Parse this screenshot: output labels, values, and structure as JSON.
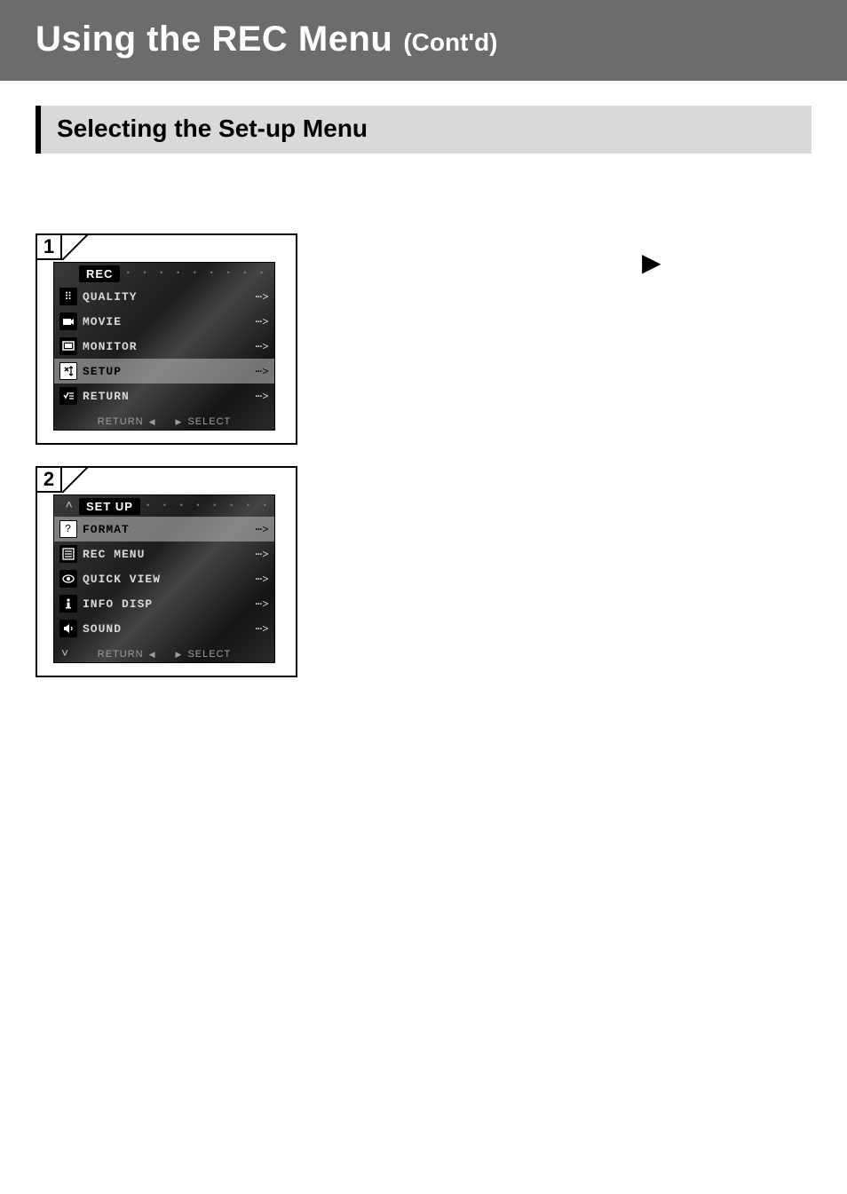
{
  "titlebar": {
    "main": "Using the REC Menu",
    "suffix": "(Cont'd)"
  },
  "section": {
    "heading": "Selecting the Set-up Menu"
  },
  "decor": {
    "play_glyph": "▶"
  },
  "panels": {
    "p1": {
      "number": "1",
      "menu_name": "REC",
      "show_scroll_up": false,
      "show_scroll_down": false,
      "items": [
        {
          "icon": "quality-icon",
          "label": "QUALITY",
          "hot": false
        },
        {
          "icon": "movie-icon",
          "label": "MOVIE",
          "hot": false
        },
        {
          "icon": "monitor-icon",
          "label": "MONITOR",
          "hot": false
        },
        {
          "icon": "setup-icon",
          "label": "SETUP",
          "hot": true
        },
        {
          "icon": "return-icon",
          "label": "RETURN",
          "hot": false
        }
      ],
      "footer": {
        "left": "RETURN",
        "right": "SELECT"
      }
    },
    "p2": {
      "number": "2",
      "menu_name": "SET UP",
      "show_scroll_up": true,
      "show_scroll_down": true,
      "items": [
        {
          "icon": "format-icon",
          "label": "FORMAT",
          "hot": true
        },
        {
          "icon": "recmenu-icon",
          "label": "REC MENU",
          "hot": false
        },
        {
          "icon": "quickview-icon",
          "label": "QUICK VIEW",
          "hot": false
        },
        {
          "icon": "info-icon",
          "label": "INFO DISP",
          "hot": false
        },
        {
          "icon": "sound-icon",
          "label": "SOUND",
          "hot": false
        }
      ],
      "footer": {
        "left": "RETURN",
        "right": "SELECT"
      }
    }
  },
  "icon_text": {
    "quality-icon": "⠿",
    "movie-icon": "🎥",
    "monitor-icon": "▣",
    "setup-icon": "✕↕",
    "return-icon": "✓≡",
    "format-icon": "?",
    "recmenu-icon": "≣",
    "quickview-icon": "◉",
    "info-icon": "i",
    "sound-icon": "🔊",
    "arrow-right": "⋯>"
  }
}
